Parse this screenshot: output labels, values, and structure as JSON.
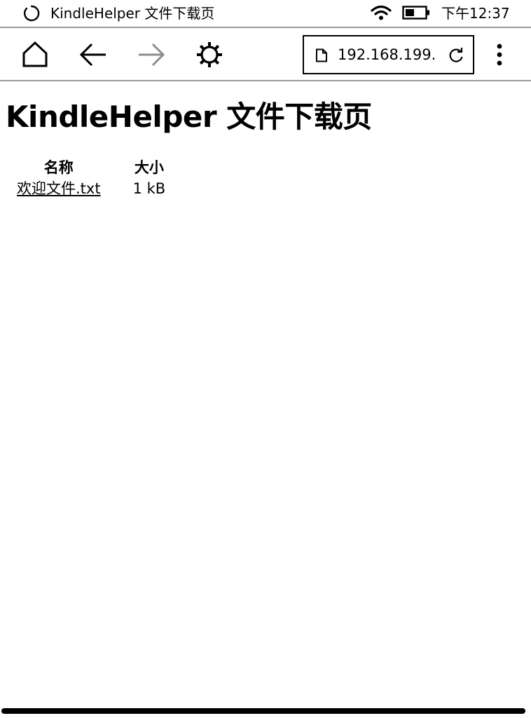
{
  "status_bar": {
    "title": "KindleHelper 文件下载页",
    "time": "下午12:37",
    "icons": [
      "loading-spinner-icon",
      "wifi-icon",
      "battery-icon"
    ]
  },
  "toolbar": {
    "icons": [
      "home-icon",
      "back-arrow-icon",
      "forward-arrow-icon",
      "settings-icon",
      "menu-icon"
    ],
    "url": "192.168.199.",
    "page_icon": "document-icon",
    "reload_icon": "reload-icon"
  },
  "page": {
    "title": "KindleHelper 文件下载页",
    "table": {
      "headers": [
        "名称",
        "大小"
      ],
      "rows": [
        {
          "name": "欢迎文件.txt",
          "size": "1 kB"
        }
      ]
    }
  }
}
